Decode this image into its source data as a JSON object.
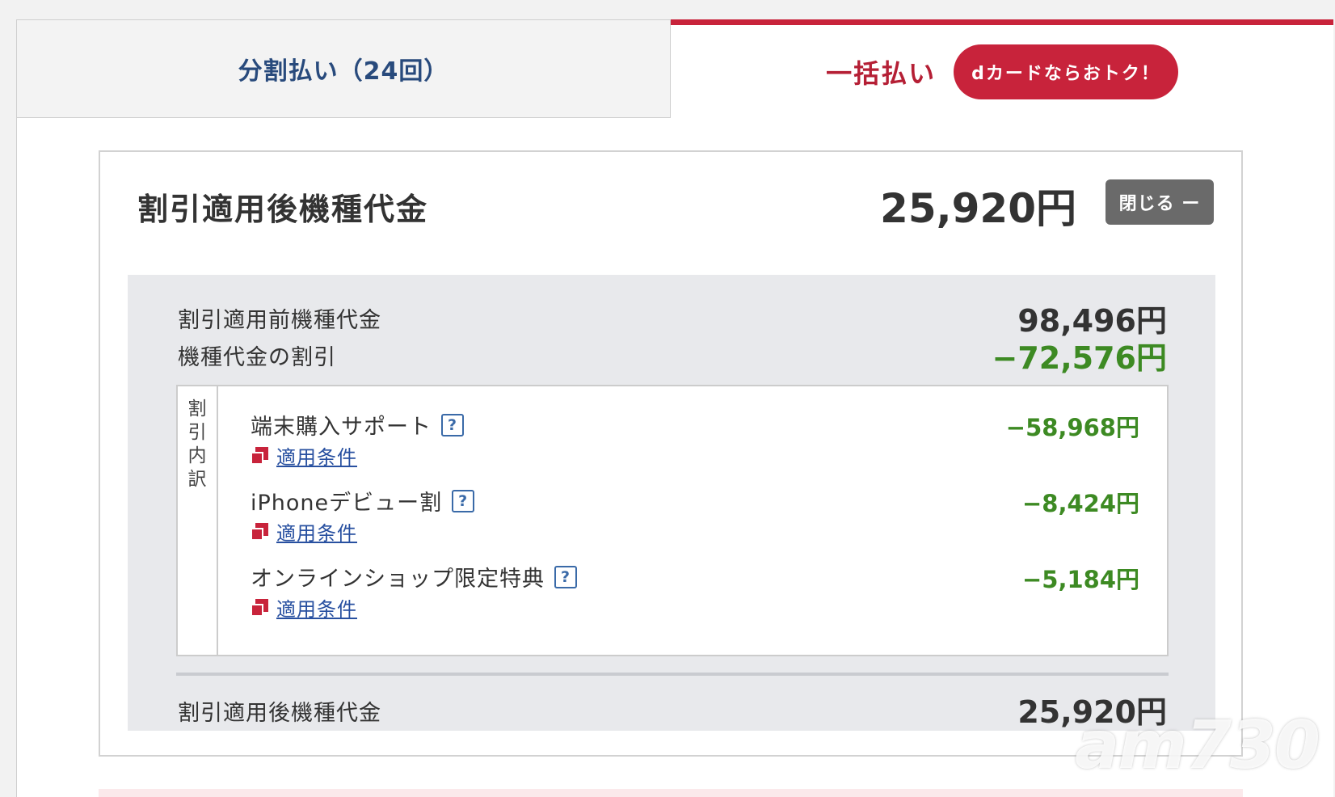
{
  "tabs": {
    "installment_label": "分割払い（24回）",
    "lump_label": "一括払い",
    "dcard_badge": "dカードならおトク！"
  },
  "summary": {
    "title": "割引適用後機種代金",
    "total": "25,920円",
    "close_label": "閉じる ー"
  },
  "breakdown": {
    "before_label": "割引適用前機種代金",
    "before_value": "98,496円",
    "discount_label": "機種代金の割引",
    "discount_value": "−72,576円",
    "side_label": [
      "割",
      "引",
      "内",
      "訳"
    ],
    "items": [
      {
        "name": "端末購入サポート",
        "link": "適用条件",
        "value": "−58,968円"
      },
      {
        "name": "iPhoneデビュー割",
        "link": "適用条件",
        "value": "−8,424円"
      },
      {
        "name": "オンラインショップ限定特典",
        "link": "適用条件",
        "value": "−5,184円"
      }
    ],
    "after_label": "割引適用後機種代金",
    "after_value": "25,920円"
  },
  "icons": {
    "help": "help-icon",
    "link": "external-link-icon"
  },
  "colors": {
    "brand_red": "#c8233b",
    "tab_blue": "#284a7c",
    "discount_green": "#3d8a23",
    "link_blue": "#2850a0"
  },
  "watermark": "am730"
}
